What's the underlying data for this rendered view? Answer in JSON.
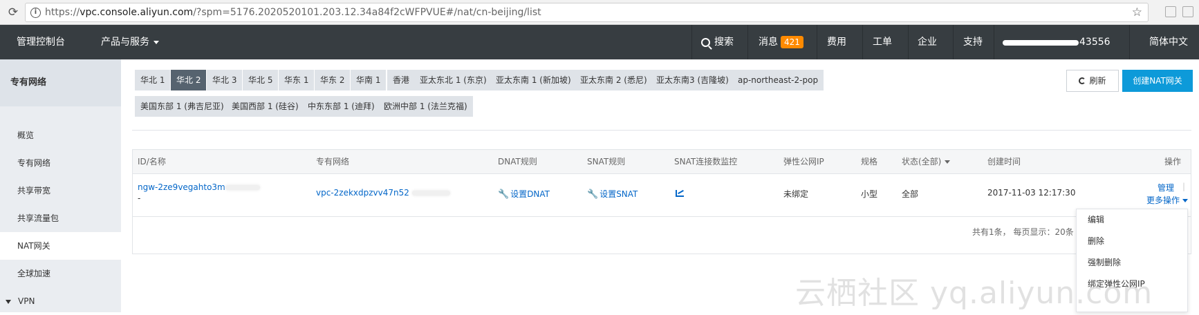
{
  "browser": {
    "url_prefix": "https://",
    "url_host": "vpc.console.aliyun.com",
    "url_rest": "/?spm=5176.2020520101.203.12.34a84f2cWFPVUE#/nat/cn-beijing/list"
  },
  "topnav": {
    "console": "管理控制台",
    "products": "产品与服务",
    "search": "搜索",
    "messages": "消息",
    "message_count": "421",
    "billing": "费用",
    "ticket": "工单",
    "enterprise": "企业",
    "support": "支持",
    "account_suffix": "43556",
    "language": "简体中文"
  },
  "sidebar": {
    "title": "专有网络",
    "items": [
      {
        "label": "概览"
      },
      {
        "label": "专有网络"
      },
      {
        "label": "共享带宽"
      },
      {
        "label": "共享流量包"
      },
      {
        "label": "NAT网关"
      },
      {
        "label": "全球加速"
      },
      {
        "label": "VPN"
      }
    ]
  },
  "regions": [
    {
      "label": "华北 1"
    },
    {
      "label": "华北 2"
    },
    {
      "label": "华北 3"
    },
    {
      "label": "华北 5"
    },
    {
      "label": "华东 1"
    },
    {
      "label": "华东 2"
    },
    {
      "label": "华南 1"
    },
    {
      "label": "香港"
    },
    {
      "label": "亚太东北 1 (东京)"
    },
    {
      "label": "亚太东南 1 (新加坡)"
    },
    {
      "label": "亚太东南 2 (悉尼)"
    },
    {
      "label": "亚太东南3 (吉隆坡)"
    },
    {
      "label": "ap-northeast-2-pop"
    },
    {
      "label": "美国东部 1 (弗吉尼亚)"
    },
    {
      "label": "美国西部 1 (硅谷)"
    },
    {
      "label": "中东东部 1 (迪拜)"
    },
    {
      "label": "欧洲中部 1 (法兰克福)"
    }
  ],
  "actions": {
    "refresh": "刷新",
    "create": "创建NAT网关"
  },
  "table": {
    "headers": {
      "id_name": "ID/名称",
      "vpc": "专有网络",
      "dnat": "DNAT规则",
      "snat": "SNAT规则",
      "snat_monitor": "SNAT连接数监控",
      "eip": "弹性公网IP",
      "spec": "规格",
      "status": "状态(全部)",
      "created": "创建时间",
      "ops": "操作"
    },
    "row": {
      "id": "ngw-2ze9vegahto3m",
      "name": "-",
      "vpc": "vpc-2zekxdpzvv47n52",
      "dnat": "设置DNAT",
      "snat": "设置SNAT",
      "eip": "未绑定",
      "spec": "小型",
      "status": "全部",
      "created": "2017-11-03 12:17:30",
      "manage": "管理",
      "more": "更多操作"
    },
    "footer": "共有1条，  每页显示：20条"
  },
  "dropdown": {
    "items": [
      {
        "label": "编辑"
      },
      {
        "label": "删除"
      },
      {
        "label": "强制删除"
      },
      {
        "label": "绑定弹性公网IP"
      }
    ]
  },
  "watermark": "云栖社区 yq.aliyun.com"
}
